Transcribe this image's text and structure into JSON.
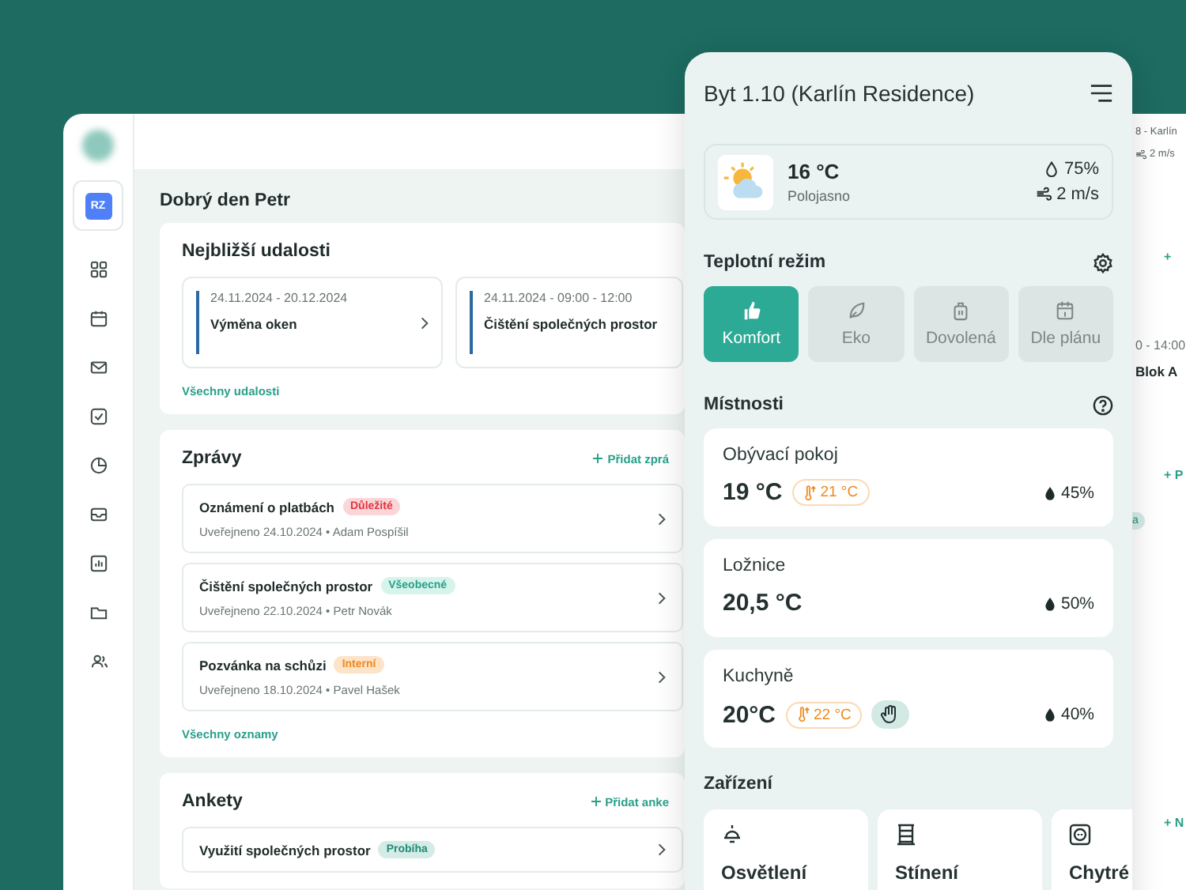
{
  "sidebar": {
    "avatar": "RZ"
  },
  "greeting": "Dobrý den Petr",
  "events": {
    "title": "Nejbližší udalosti",
    "items": [
      {
        "date": "24.11.2024 - 20.12.2024",
        "title": "Výměna oken"
      },
      {
        "date": "24.11.2024 - 09:00 - 12:00",
        "title": "Čištění společných prostor"
      }
    ],
    "link": "Všechny udalosti"
  },
  "messages": {
    "title": "Zprávy",
    "add": "Přidat zprá",
    "items": [
      {
        "title": "Oznámení o platbách",
        "tag": {
          "label": "Důležité",
          "kind": "important"
        },
        "meta": "Uveřejneno 24.10.2024 • Adam Pospíšil"
      },
      {
        "title": "Čištění společných prostor",
        "tag": {
          "label": "Všeobecné",
          "kind": "general"
        },
        "meta": "Uveřejneno 22.10.2024 • Petr Novák"
      },
      {
        "title": "Pozvánka na schůzi",
        "tag": {
          "label": "Interní",
          "kind": "internal"
        },
        "meta": "Uveřejneno 18.10.2024 • Pavel Hašek"
      }
    ],
    "link": "Všechny oznamy"
  },
  "polls": {
    "title": "Ankety",
    "add": "Přidat anke",
    "items": [
      {
        "title": "Využití společných prostor",
        "tag": {
          "label": "Probíha",
          "kind": "running"
        }
      }
    ]
  },
  "fragments": [
    {
      "kind": "small",
      "text": "8 - Karlín"
    },
    {
      "kind": "wind",
      "text": "2 m/s"
    },
    {
      "kind": "add",
      "text": "+"
    },
    {
      "kind": "date",
      "text": "0 - 14:00"
    },
    {
      "kind": "title",
      "text": "Blok A"
    },
    {
      "kind": "add",
      "text": "+ P"
    },
    {
      "kind": "badge",
      "text": "a"
    },
    {
      "kind": "add",
      "text": "+ N"
    }
  ],
  "phone": {
    "title": "Byt 1.10 (Karlín Residence)",
    "weather": {
      "temp": "16 °C",
      "condition": "Polojasno",
      "humidity": "75%",
      "wind": "2 m/s"
    },
    "mode_title": "Teplotní režim",
    "modes": [
      {
        "label": "Komfort",
        "selected": true
      },
      {
        "label": "Eko",
        "selected": false
      },
      {
        "label": "Dovolená",
        "selected": false
      },
      {
        "label": "Dle plánu",
        "selected": false
      }
    ],
    "rooms_title": "Místnosti",
    "rooms": [
      {
        "name": "Obývací pokoj",
        "temp": "19 °C",
        "target": "21 °C",
        "manual": false,
        "humidity": "45%"
      },
      {
        "name": "Ložnice",
        "temp": "20,5 °C",
        "manual": false,
        "humidity": "50%"
      },
      {
        "name": "Kuchyně",
        "temp": "20°C",
        "target": "22 °C",
        "manual": true,
        "humidity": "40%"
      }
    ],
    "devices_title": "Zařízení",
    "devices": [
      {
        "label": "Osvětlení"
      },
      {
        "label": "Stínení"
      },
      {
        "label": "Chytré"
      }
    ]
  }
}
